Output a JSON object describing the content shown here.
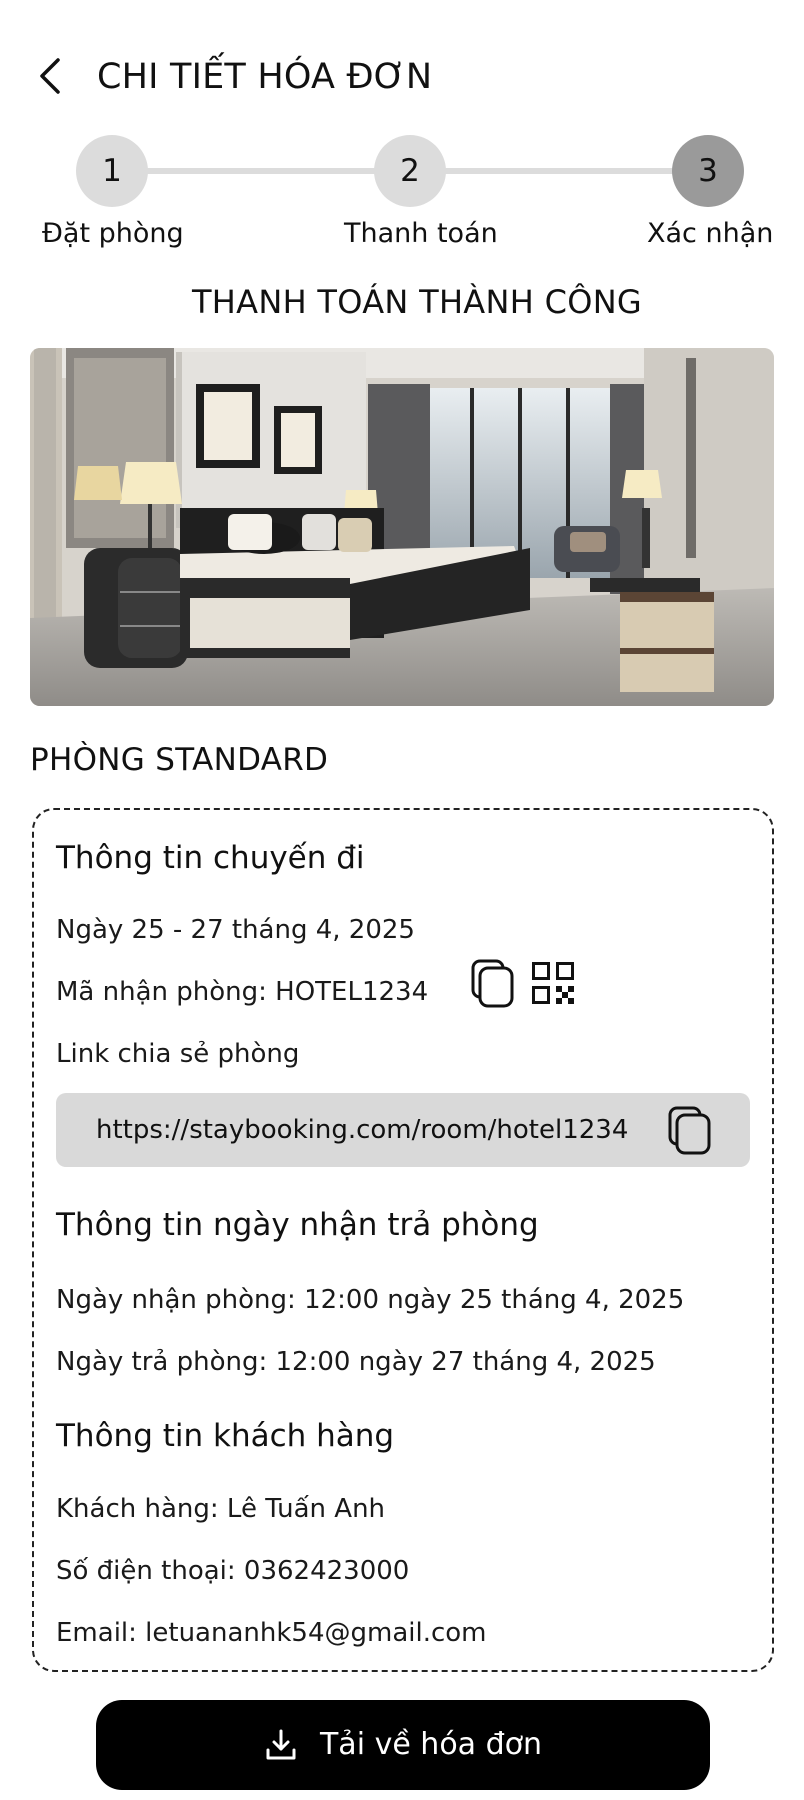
{
  "header": {
    "title": "CHI TIẾT HÓA ĐƠN",
    "back_icon": "chevron-left-icon"
  },
  "stepper": {
    "steps": [
      {
        "number": "1",
        "label": "Đặt phòng"
      },
      {
        "number": "2",
        "label": "Thanh toán"
      },
      {
        "number": "3",
        "label": "Xác nhận"
      }
    ],
    "current_step": 3
  },
  "status": {
    "title": "THANH TOÁN THÀNH CÔNG"
  },
  "room": {
    "name": "PHÒNG STANDARD",
    "photo_icon": "hotel-room-photo"
  },
  "trip": {
    "section_title": "Thông tin chuyến đi",
    "date": "Ngày 25 - 27 tháng 4, 2025",
    "checkin_code": "Mã nhận phòng: HOTEL1234",
    "share_label": "Link chia sẻ phòng",
    "share_link": "https://staybooking.com/room/hotel1234"
  },
  "checkin_info": {
    "section_title": "Thông tin ngày nhận trả phòng",
    "checkin": "Ngày nhận phòng: 12:00 ngày 25 tháng 4, 2025",
    "checkout": "Ngày trả phòng: 12:00 ngày 27 tháng 4, 2025"
  },
  "customer": {
    "section_title": "Thông tin khách hàng",
    "name": "Khách hàng: Lê Tuấn Anh",
    "phone": "Số điện thoại: 0362423000",
    "email": "Email: letuananhk54@gmail.com"
  },
  "actions": {
    "download_label": "Tải về hóa đơn",
    "download_icon": "download-icon"
  },
  "colors": {
    "step_inactive": "#dcdcdc",
    "step_active": "#9a9a9a",
    "button_bg": "#000000",
    "link_box_bg": "#d9d9d9"
  }
}
